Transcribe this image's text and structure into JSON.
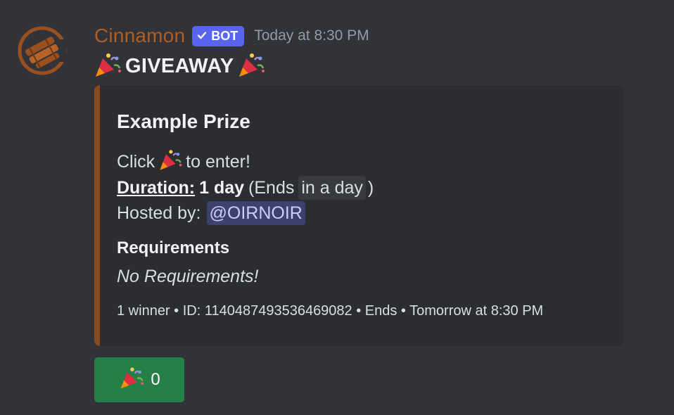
{
  "message": {
    "author": "Cinnamon",
    "bot_badge": "BOT",
    "timestamp": "Today at 8:30 PM",
    "content_title": "GIVEAWAY",
    "emoji_icon": "party-popper-icon"
  },
  "embed": {
    "accent_color": "#8a4a1f",
    "title": "Example Prize",
    "click_prefix": "Click",
    "click_suffix": "to enter!",
    "duration_label": "Duration:",
    "duration_value": "1 day",
    "ends_prefix": "(Ends",
    "ends_relative": "in a day",
    "ends_suffix": ")",
    "hosted_label": "Hosted by:",
    "host_mention": "@OIRNOIR",
    "requirements_name": "Requirements",
    "requirements_value": "No Requirements!",
    "footer": "1 winner • ID: 1140487493536469082 • Ends • Tomorrow at 8:30 PM"
  },
  "button": {
    "count": "0",
    "color": "#248046"
  },
  "colors": {
    "background": "#313338",
    "username": "#b15e23",
    "bot_badge": "#5865f2"
  }
}
